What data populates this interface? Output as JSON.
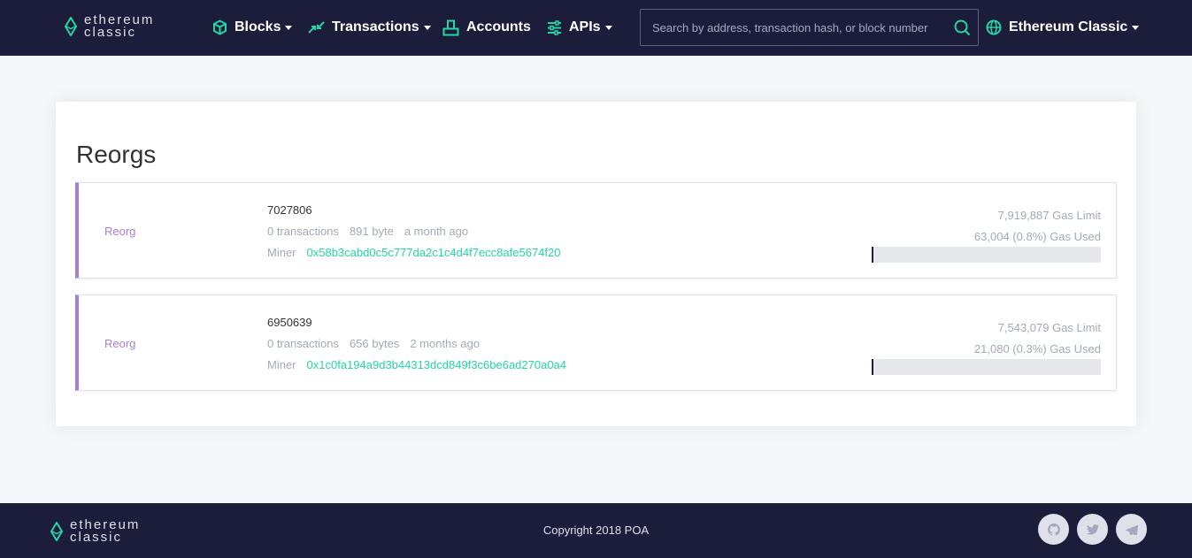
{
  "colors": {
    "header_bg": "#1c1d3a",
    "accent": "#23d6a2",
    "reorg_purple": "#a67fd6"
  },
  "header": {
    "logo": {
      "line1": "ethereum",
      "line2": "classic"
    },
    "nav": {
      "blocks": "Blocks",
      "transactions": "Transactions",
      "accounts": "Accounts",
      "apis": "APIs"
    },
    "search": {
      "placeholder": "Search by address, transaction hash, or block number",
      "value": ""
    },
    "network": "Ethereum Classic"
  },
  "main": {
    "title": "Reorgs",
    "reorgs": [
      {
        "type": "Reorg",
        "number": "7027806",
        "transactions": "0 transactions",
        "size": "891 byte",
        "age": "a month ago",
        "miner_label": "Miner",
        "miner": "0x58b3cabd0c5c777da2c1c4d4f7ecc8afe5674f20",
        "gas_limit": "7,919,887 Gas Limit",
        "gas_used": "63,004 (0.8%) Gas Used",
        "gas_used_percent": 0.8
      },
      {
        "type": "Reorg",
        "number": "6950639",
        "transactions": "0 transactions",
        "size": "656 bytes",
        "age": "2 months ago",
        "miner_label": "Miner",
        "miner": "0x1c0fa194a9d3b44313dcd849f3c6be6ad270a0a4",
        "gas_limit": "7,543,079 Gas Limit",
        "gas_used": "21,080 (0.3%) Gas Used",
        "gas_used_percent": 0.3
      }
    ]
  },
  "footer": {
    "logo": {
      "line1": "ethereum",
      "line2": "classic"
    },
    "copyright": "Copyright 2018 POA",
    "social_icons": [
      "github-icon",
      "twitter-icon",
      "telegram-icon"
    ]
  }
}
